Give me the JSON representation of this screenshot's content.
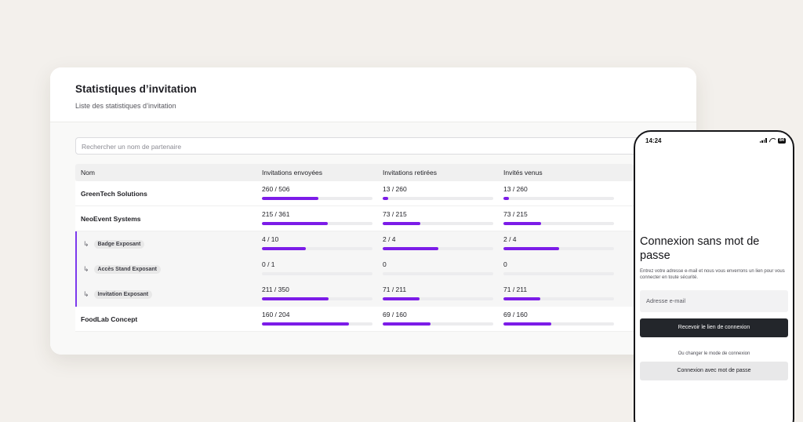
{
  "panel": {
    "title": "Statistiques d’invitation",
    "subtitle": "Liste des statistiques d’invitation",
    "search_placeholder": "Rechercher un nom de partenaire"
  },
  "table": {
    "headers": [
      "Nom",
      "Invitations envoyées",
      "Invitations retirées",
      "Invités venus"
    ],
    "rows": [
      {
        "name": "GreenTech Solutions",
        "sent": "260 / 506",
        "sent_ratio": 0.514,
        "withdrawn": "13 / 260",
        "withdrawn_ratio": 0.05,
        "came": "13 / 260",
        "came_ratio": 0.05
      },
      {
        "name": "NeoEvent Systems",
        "sent": "215 / 361",
        "sent_ratio": 0.596,
        "withdrawn": "73 / 215",
        "withdrawn_ratio": 0.34,
        "came": "73 / 215",
        "came_ratio": 0.34
      },
      {
        "name": "Badge Exposant",
        "sent": "4 / 10",
        "sent_ratio": 0.4,
        "withdrawn": "2 / 4",
        "withdrawn_ratio": 0.5,
        "came": "2 / 4",
        "came_ratio": 0.5
      },
      {
        "name": "Accès Stand Exposant",
        "sent": "0 / 1",
        "sent_ratio": 0,
        "withdrawn": "0",
        "withdrawn_ratio": 0,
        "came": "0",
        "came_ratio": 0
      },
      {
        "name": "Invitation Exposant",
        "sent": "211 / 350",
        "sent_ratio": 0.603,
        "withdrawn": "71 / 211",
        "withdrawn_ratio": 0.336,
        "came": "71 / 211",
        "came_ratio": 0.336
      },
      {
        "name": "FoodLab Concept",
        "sent": "160 / 204",
        "sent_ratio": 0.784,
        "withdrawn": "69 / 160",
        "withdrawn_ratio": 0.431,
        "came": "69 / 160",
        "came_ratio": 0.431
      }
    ]
  },
  "phone": {
    "time": "14:24",
    "battery": "84",
    "title": "Connexion sans mot de passe",
    "description": "Entrez votre adresse e-mail et nous vous enverrons un lien pour vous connecter en toute sécurité.",
    "email_placeholder": "Adresse e-mail",
    "primary_button": "Recevoir le lien de connexion",
    "or_text": "Ou changer le mode de connexion",
    "secondary_button": "Connexion avec mot de passe"
  },
  "colors": {
    "accent": "#7c1ce8",
    "background": "#f3f0ec",
    "dark_button": "#23262b"
  }
}
